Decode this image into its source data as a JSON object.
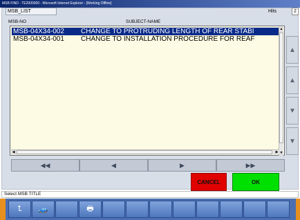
{
  "window": {
    "title": "MSB FIND - TE2000000 - Microsoft Internet Explorer - [Working Offline]"
  },
  "header": {
    "list_title": "MSB_LIST",
    "col_msb_no": "MSB-NO",
    "col_subject": "SUBJECT-NAME",
    "hits_label": "Hits",
    "hits_value": "2"
  },
  "rows": [
    {
      "msb_no": "MSB-04X34-002",
      "subject": "CHANGE TO PROTRUDING LENGTH OF REAR STABI",
      "selected": true
    },
    {
      "msb_no": "MSB-04X34-001",
      "subject": "CHANGE TO INSTALLATION PROCEDURE FOR REAF",
      "selected": false
    }
  ],
  "side_buttons": [
    {
      "name": "page-up-button",
      "icon": "triangle-up-icon",
      "glyph": "▲"
    },
    {
      "name": "line-up-button",
      "icon": "triangle-up-icon",
      "glyph": "▲"
    },
    {
      "name": "line-down-button",
      "icon": "triangle-down-icon",
      "glyph": "▼"
    },
    {
      "name": "page-down-button",
      "icon": "triangle-down-icon",
      "glyph": "▼"
    }
  ],
  "nav_buttons": [
    {
      "name": "first-page-button",
      "icon": "double-left-arrow-icon",
      "glyph": "◀◀"
    },
    {
      "name": "previous-button",
      "icon": "left-arrow-icon",
      "glyph": "◀"
    },
    {
      "name": "next-button",
      "icon": "right-arrow-icon",
      "glyph": "▶"
    },
    {
      "name": "last-page-button",
      "icon": "double-right-arrow-icon",
      "glyph": "▶▶"
    }
  ],
  "actions": {
    "cancel_label": "CANCEL",
    "ok_label": "OK"
  },
  "status_text": "Select MSB TITLE",
  "toolbar": {
    "buttons": [
      {
        "name": "back-button",
        "icon": "return-arrow-icon",
        "glyph": "⮤"
      },
      {
        "name": "vehicle-button",
        "icon": "car-icon",
        "glyph": "🚙"
      },
      {
        "name": "blank-button-3",
        "icon": "",
        "glyph": ""
      },
      {
        "name": "print-button",
        "icon": "printer-icon",
        "glyph": "🖶"
      }
    ]
  },
  "colors": {
    "selection": "#0a2a8a",
    "list_background": "#fdfbe3",
    "cancel": "#e00000",
    "ok": "#00e000",
    "toolbar": "#4b6fb0",
    "toolbar_edge": "#e8901e"
  }
}
